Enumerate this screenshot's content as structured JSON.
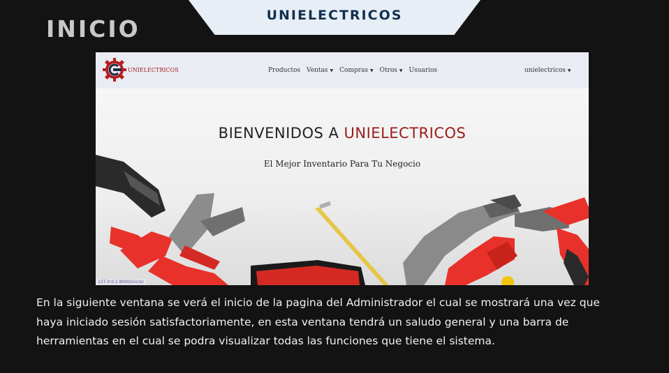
{
  "slide": {
    "banner": "UNIELECTRICOS",
    "title": "INICIO",
    "description": "En la siguiente ventana se verá el inicio de la pagina del Administrador el cual se mostrará una vez que\nhaya iniciado sesión satisfactoriamente, en esta ventana tendrá un saludo general y una barra de\nherramientas en el  cual se podra visualizar todas las funciones que tiene el sistema."
  },
  "app": {
    "brand": "UNIELECTRICOS",
    "nav": [
      {
        "label": "Productos",
        "dropdown": false
      },
      {
        "label": "Ventas",
        "dropdown": true
      },
      {
        "label": "Compras",
        "dropdown": true
      },
      {
        "label": "Otros",
        "dropdown": true
      },
      {
        "label": "Usuarios",
        "dropdown": false
      }
    ],
    "user": "unielectricos",
    "hero_title_part1": "BIENVENIDOS A ",
    "hero_title_part2": "UNIELECTRICOS",
    "hero_subtitle": "El Mejor Inventario Para Tu Negocio",
    "status_url": "127.0.0.1:8000/inicio/"
  },
  "colors": {
    "background": "#131313",
    "banner_bg": "#e8eef6",
    "banner_text": "#12304f",
    "brand_red": "#a32020",
    "tool_red": "#e8312a"
  },
  "icons": [
    "gear-logo-icon",
    "caret-down-icon"
  ]
}
